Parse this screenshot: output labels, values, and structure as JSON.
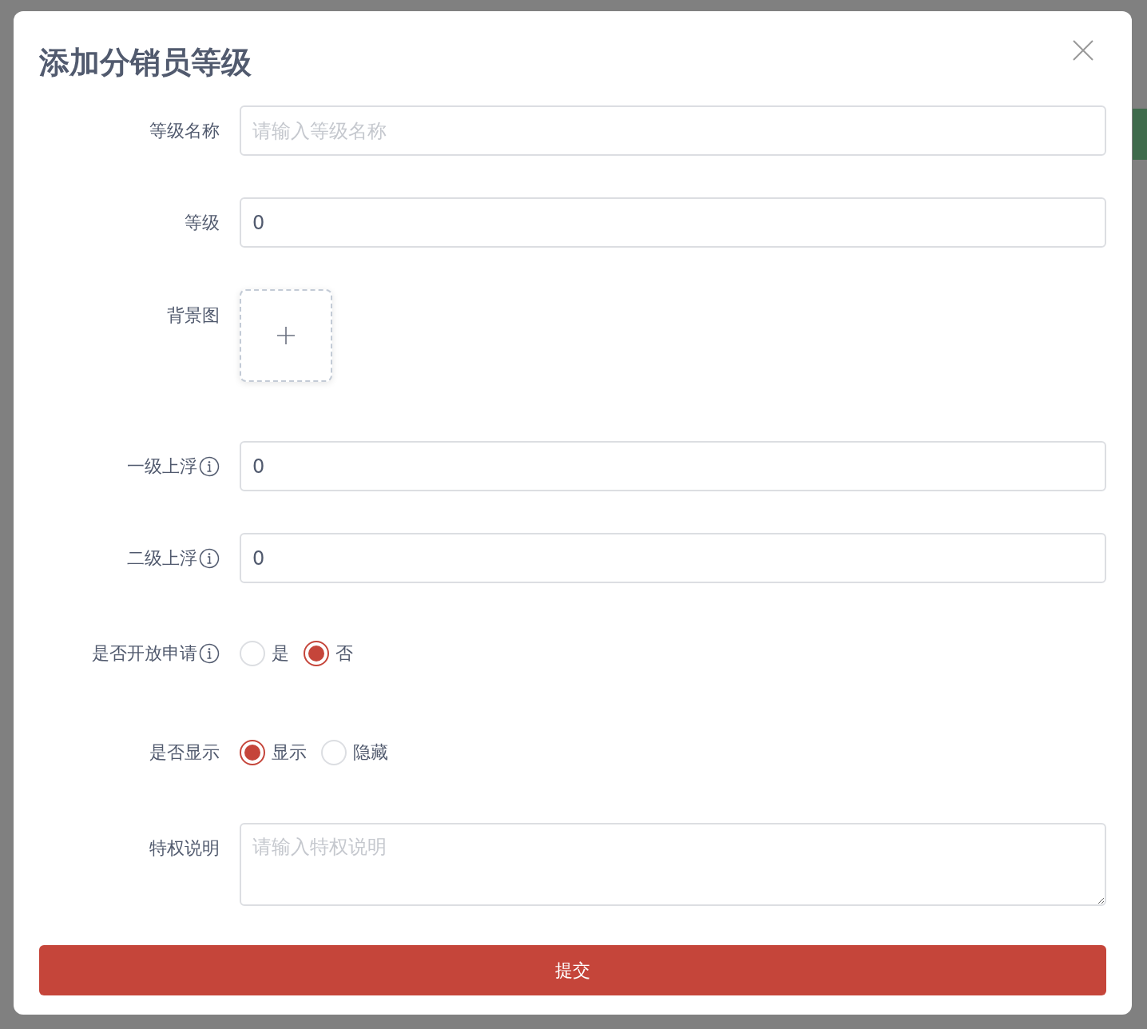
{
  "dialog": {
    "title": "添加分销员等级",
    "fields": [
      {
        "kind": "text",
        "label": "等级名称",
        "info": false,
        "placeholder": "请输入等级名称"
      },
      {
        "kind": "text",
        "label": "等级",
        "info": false,
        "value": "0"
      },
      {
        "kind": "upload",
        "label": "背景图",
        "info": false
      },
      {
        "kind": "text",
        "label": "一级上浮",
        "info": true,
        "value": "0"
      },
      {
        "kind": "text",
        "label": "二级上浮",
        "info": true,
        "value": "0"
      },
      {
        "kind": "radio",
        "label": "是否开放申请",
        "info": true,
        "options": [
          {
            "label": "是",
            "selected": false
          },
          {
            "label": "否",
            "selected": true
          }
        ]
      },
      {
        "kind": "radio",
        "label": "是否显示",
        "info": false,
        "options": [
          {
            "label": "显示",
            "selected": true
          },
          {
            "label": "隐藏",
            "selected": false
          }
        ]
      },
      {
        "kind": "textarea",
        "label": "特权说明",
        "info": false,
        "placeholder": "请输入特权说明"
      }
    ],
    "submit": "提交"
  }
}
